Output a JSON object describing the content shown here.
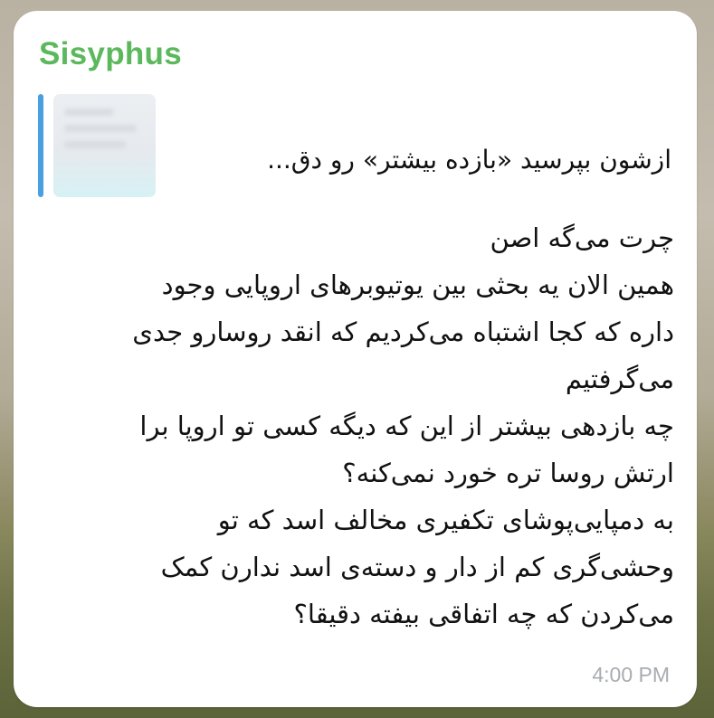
{
  "message": {
    "sender": "Sisyphus",
    "reply_preview": "ازشون بپرسید «بازده بیشتر» رو دق...",
    "lines": [
      "چرت می‌گه اصن",
      "همین الان یه بحثی بین یوتیوبرهای اروپایی وجود",
      "داره که کجا اشتباه می‌کردیم که انقد روسارو جدی",
      "می‌گرفتیم",
      "چه بازدهی بیشتر از این که دیگه کسی تو اروپا برا",
      "ارتش روسا تره خورد نمی‌کنه؟",
      "به دمپایی‌پوشای تکفیری مخالف اسد که تو",
      "وحشی‌گری کم از دار و دسته‌ی اسد ندارن کمک",
      "می‌کردن که چه اتفاقی بیفته دقیقا؟"
    ],
    "time": "4:00 PM"
  },
  "colors": {
    "sender": "#5cb85c",
    "reply_bar": "#4a9fe0",
    "time": "#a8acb0",
    "bubble": "#ffffff"
  }
}
